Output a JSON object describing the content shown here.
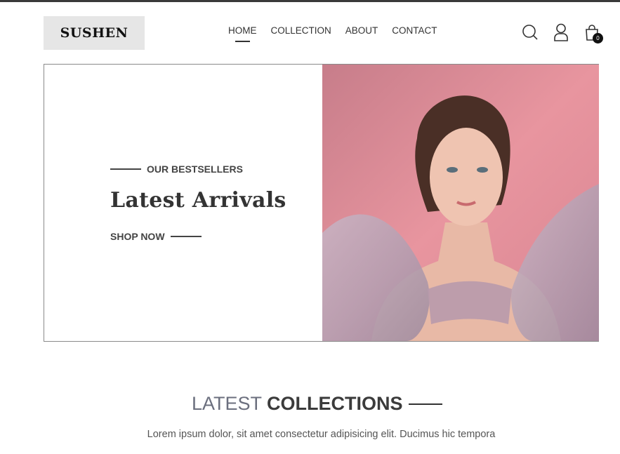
{
  "brand": {
    "logo_text": "SUSHEN"
  },
  "nav": {
    "items": [
      {
        "label": "HOME",
        "active": true
      },
      {
        "label": "COLLECTION",
        "active": false
      },
      {
        "label": "ABOUT",
        "active": false
      },
      {
        "label": "CONTACT",
        "active": false
      }
    ]
  },
  "header_icons": {
    "search": "search-icon",
    "account": "user-icon",
    "cart": "shopping-bag-icon",
    "cart_count": "0"
  },
  "hero": {
    "eyebrow": "OUR BESTSELLERS",
    "headline": "Latest Arrivals",
    "cta_label": "SHOP NOW",
    "image": "hero-model-photo"
  },
  "collections": {
    "title_light": "LATEST",
    "title_bold": "COLLECTIONS",
    "subtitle": "Lorem ipsum dolor, sit amet consectetur adipisicing elit. Ducimus hic tempora"
  },
  "colors": {
    "accent": "#333333",
    "hero_bg": "#e3909a",
    "logo_bg": "#e6e6e6"
  }
}
